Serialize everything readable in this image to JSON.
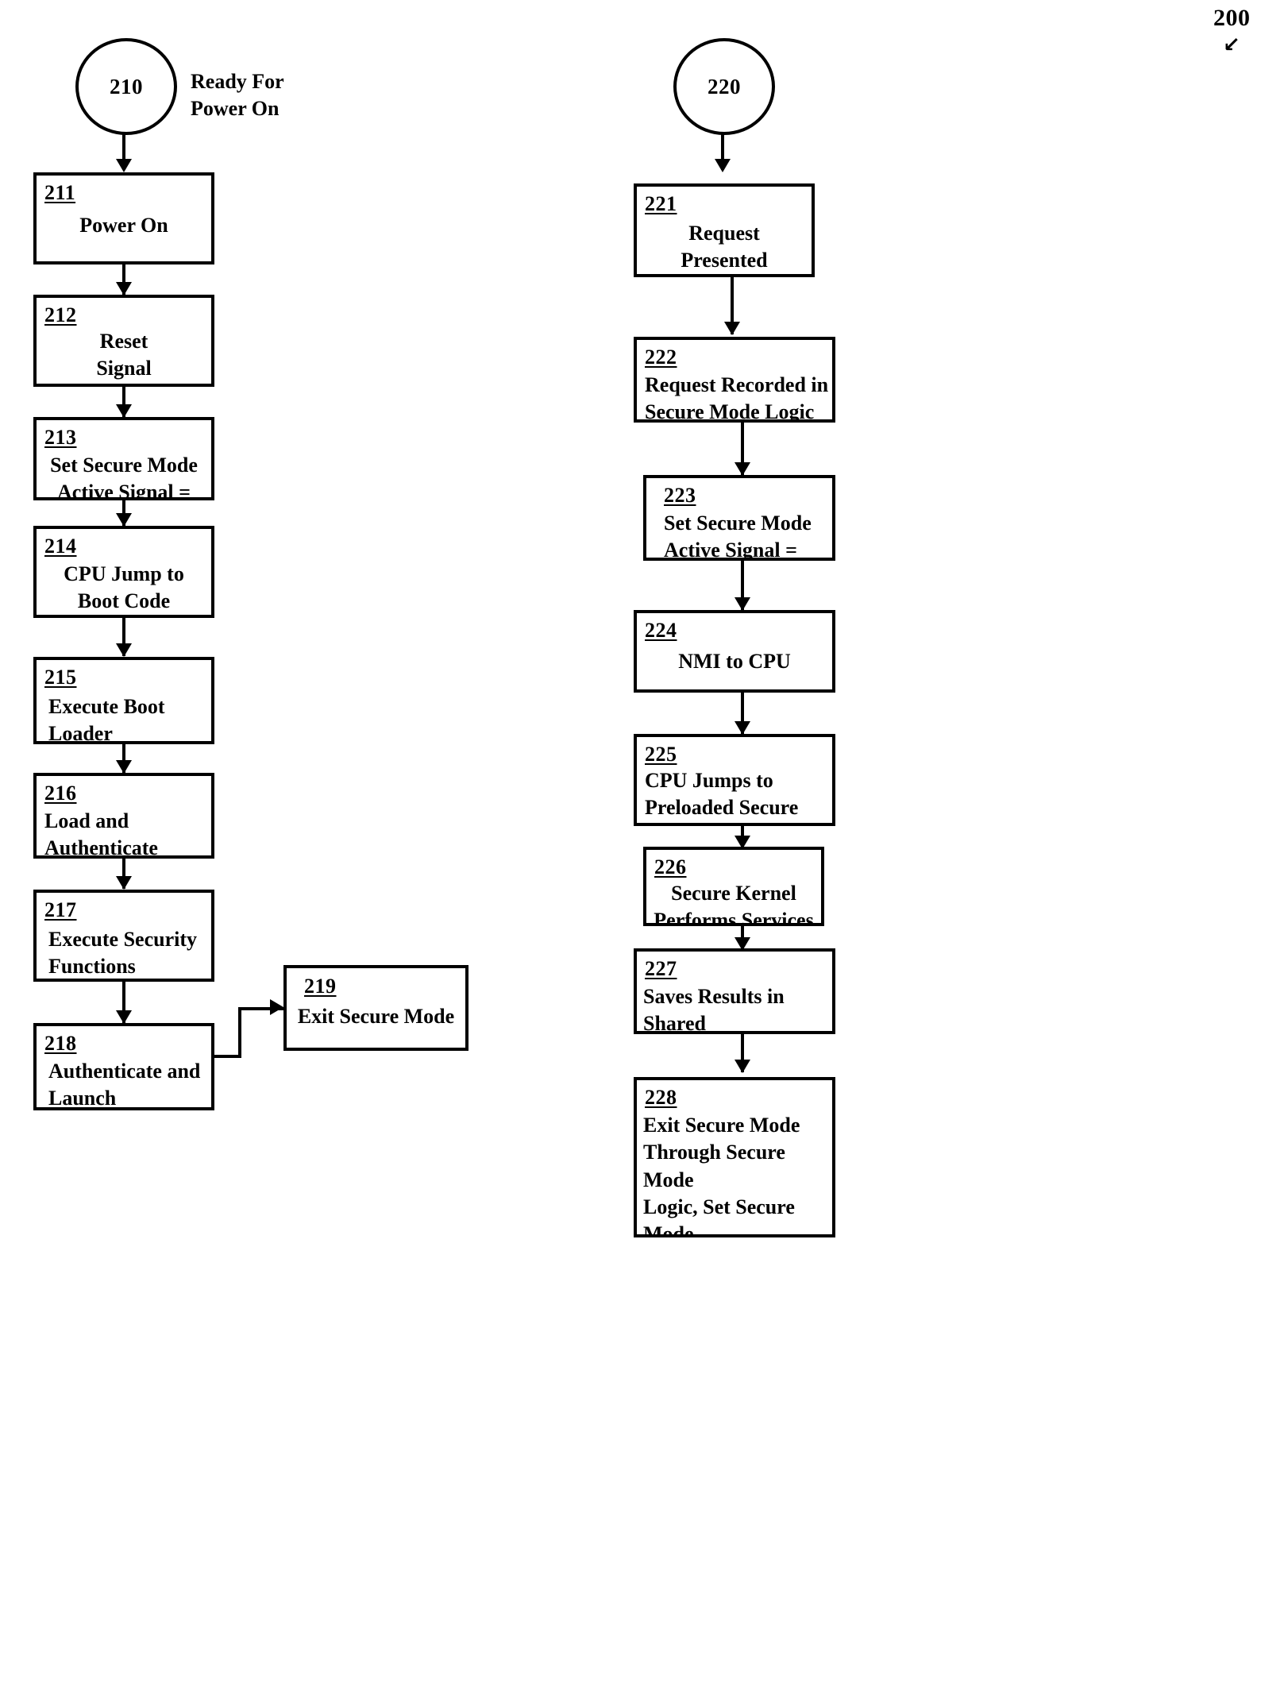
{
  "figure": {
    "number": "200",
    "callout_arrow": "↙"
  },
  "left_flow": {
    "start": {
      "id": "210",
      "annotation": "Ready For\nPower On"
    },
    "steps": [
      {
        "id": "211",
        "text": "Power On",
        "align": "center"
      },
      {
        "id": "212",
        "text": "Reset\nSignal",
        "align": "center"
      },
      {
        "id": "213",
        "text": "Set Secure Mode\nActive Signal = True",
        "align": "center"
      },
      {
        "id": "214",
        "text": "CPU Jump to\nBoot  Code",
        "align": "center"
      },
      {
        "id": "215",
        "text": "Execute Boot\nLoader",
        "align": "left"
      },
      {
        "id": "216",
        "text": "Load and Authenticate\nSecurity Functions",
        "align": "left"
      },
      {
        "id": "217",
        "text": "Execute Security\nFunctions",
        "align": "left"
      },
      {
        "id": "218",
        "text": "Authenticate and\nLaunch Application",
        "align": "left"
      }
    ],
    "exit": {
      "id": "219",
      "text": "Exit Secure Mode",
      "align": "center"
    }
  },
  "right_flow": {
    "start": {
      "id": "220",
      "annotation": ""
    },
    "steps": [
      {
        "id": "221",
        "text": "Request\nPresented",
        "align": "center"
      },
      {
        "id": "222",
        "text": "Request Recorded in\nSecure Mode Logic",
        "align": "left"
      },
      {
        "id": "223",
        "text": "Set  Secure Mode\nActive Signal = True",
        "align": "left"
      },
      {
        "id": "224",
        "text": "NMI to CPU",
        "align": "center"
      },
      {
        "id": "225",
        "text": "CPU Jumps to\nPreloaded Secure\nKernel",
        "align": "left"
      },
      {
        "id": "226",
        "text": "Secure Kernel\nPerforms Services",
        "align": "center"
      },
      {
        "id": "227",
        "text": "Saves Results in Shared\nMemory",
        "align": "left"
      },
      {
        "id": "228",
        "text": "Exit Secure Mode\nThrough Secure Mode\nLogic, Set Secure Mode\nActive\n Signal = False",
        "align": "left"
      }
    ]
  }
}
